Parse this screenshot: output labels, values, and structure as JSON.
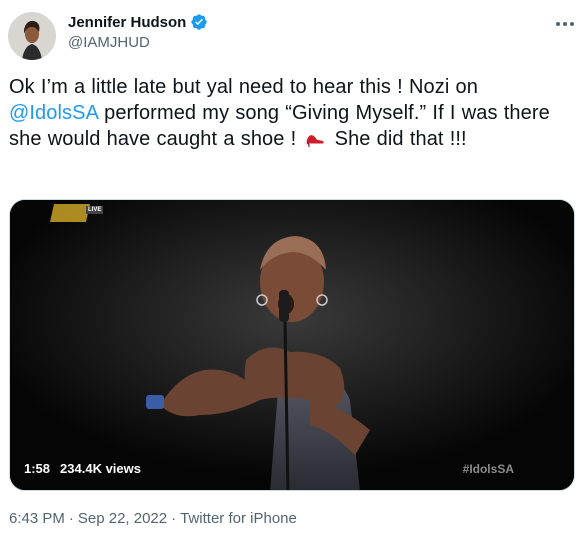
{
  "author": {
    "display_name": "Jennifer Hudson",
    "handle": "@IAMJHUD",
    "verified_icon": "verified-badge-icon",
    "verified_color": "#1d9bf0"
  },
  "more_icon": "more-horizontal-icon",
  "tweet": {
    "text_part1": "Ok I’m a little late but yal need to hear this ! Nozi on ",
    "mention": "@IdolsSA",
    "text_part2": " performed my song “Giving Myself.” If I was there she would have caught a shoe ! ",
    "emoji": "high-heel-shoe-icon",
    "text_part3": " She did that !!!"
  },
  "media": {
    "duration": "1:58",
    "views": "234.4K views",
    "hashtag_overlay": "#IdolsSA",
    "live_badge": "LIVE"
  },
  "meta": {
    "time": "6:43 PM",
    "separator1": "·",
    "date": "Sep 22, 2022",
    "separator2": "·",
    "source": "Twitter for iPhone"
  },
  "colors": {
    "mention": "#1d9bf0",
    "secondary_text": "#536471",
    "primary_text": "#0f1419"
  }
}
